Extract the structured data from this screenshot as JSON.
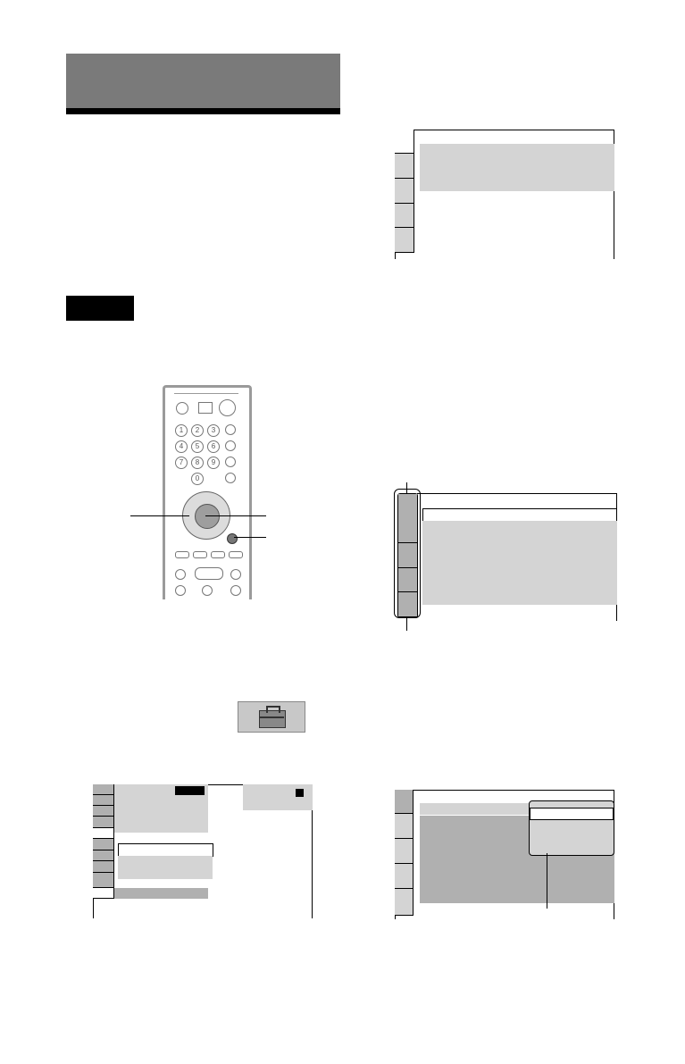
{
  "page": {
    "section_header": "",
    "notice_label": "",
    "footer_text": ""
  },
  "remote": {
    "name": "remote-control",
    "keys": [
      "1",
      "2",
      "3",
      "4",
      "5",
      "6",
      "7",
      "8",
      "9",
      "0"
    ]
  },
  "setup_icon": {
    "name": "setup-toolbox-icon"
  }
}
